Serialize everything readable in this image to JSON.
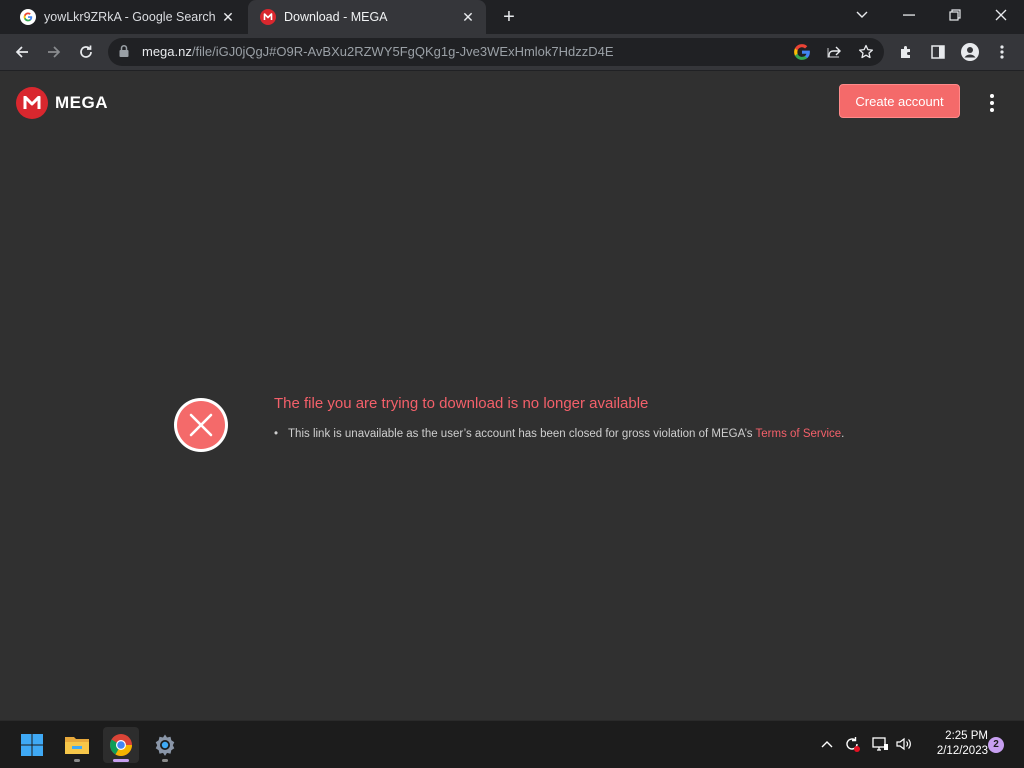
{
  "browser": {
    "tabs": [
      {
        "title": "yowLkr9ZRkA - Google Search",
        "icon": "google-icon",
        "active": false
      },
      {
        "title": "Download - MEGA",
        "icon": "mega-icon",
        "active": true
      }
    ],
    "url_host": "mega.nz",
    "url_path": "/file/iGJ0jQgJ#O9R-AvBXu2RZWY5FgQKg1g-Jve3WExHmlok7HdzzD4E"
  },
  "mega": {
    "logo_text": "MEGA",
    "logo_letter": "M",
    "create_account_label": "Create account",
    "error_title": "The file you are trying to download is no longer available",
    "error_detail": "This link is unavailable as the user’s account has been closed for gross violation of MEGA’s ",
    "tos_link": "Terms of Service",
    "tos_period": "."
  },
  "colors": {
    "accent_red": "#f4606a",
    "button": "#f46a6a",
    "brand": "#d9272e"
  },
  "taskbar": {
    "apps": [
      "windows-start-icon",
      "file-explorer-icon",
      "chrome-icon",
      "settings-icon"
    ],
    "time": "2:25 PM",
    "date": "2/12/2023",
    "notifications": "2"
  }
}
